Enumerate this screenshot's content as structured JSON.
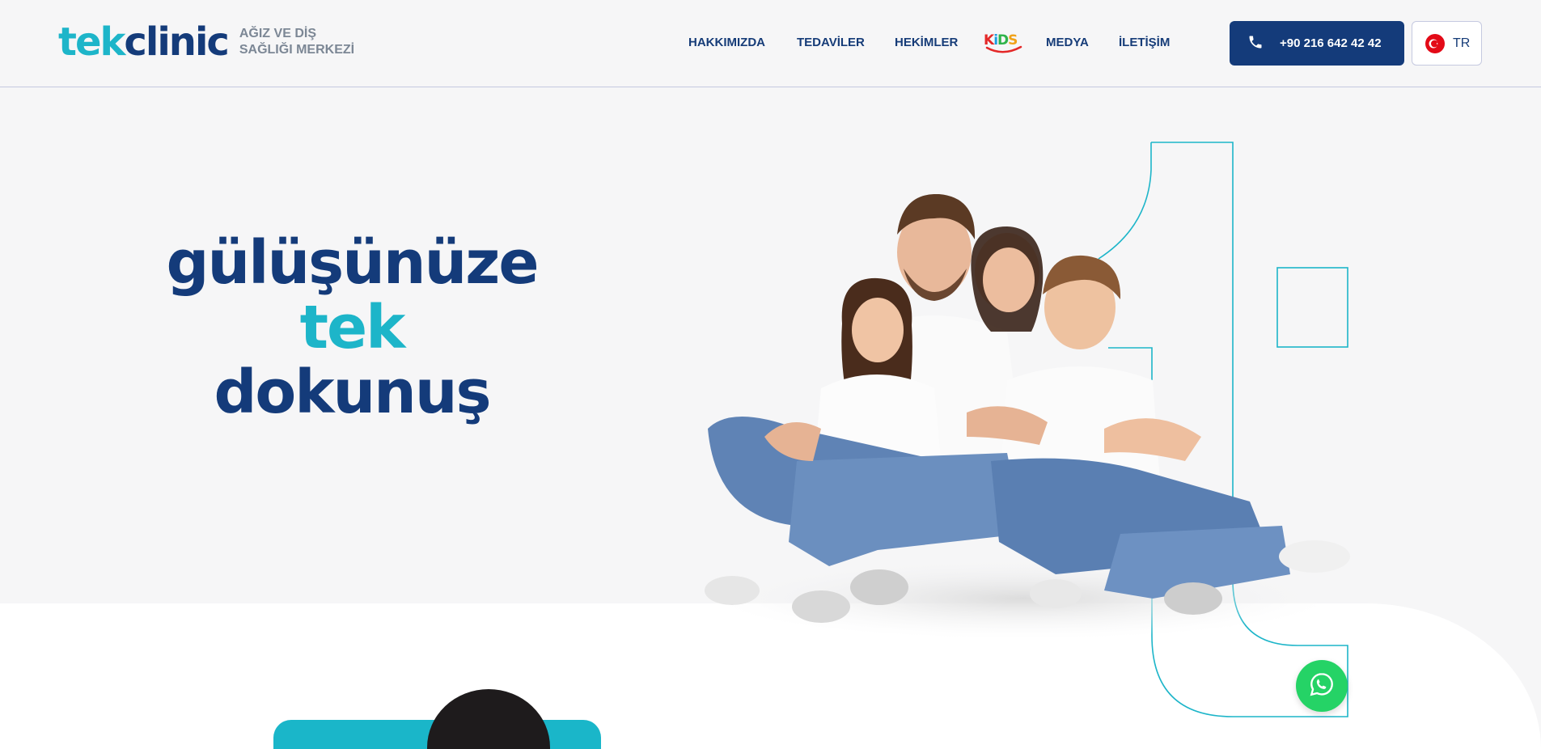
{
  "header": {
    "logo": {
      "word_a": "tek",
      "word_b": "clinic",
      "subtitle_line1": "AĞIZ VE DİŞ",
      "subtitle_line2": "SAĞLIĞI MERKEZİ"
    },
    "nav": [
      {
        "label": "HAKKIMIZDA"
      },
      {
        "label": "TEDAVİLER"
      },
      {
        "label": "HEKİMLER"
      },
      {
        "label": "KIDS"
      },
      {
        "label": "MEDYA"
      },
      {
        "label": "İLETİŞİM"
      }
    ],
    "phone": {
      "label": "+90 216 642 42 42",
      "icon": "phone-icon"
    },
    "language": {
      "label": "TR",
      "icon": "turkey-flag-icon"
    }
  },
  "hero": {
    "line1": "gülüşünüze",
    "line2": "tek",
    "line3": "dokunuş",
    "image": "family-photo"
  },
  "floating": {
    "whatsapp_icon": "whatsapp-icon"
  },
  "colors": {
    "navy": "#143b7a",
    "teal": "#1db5c9",
    "whatsapp": "#25d366",
    "background": "#f6f6f7"
  }
}
